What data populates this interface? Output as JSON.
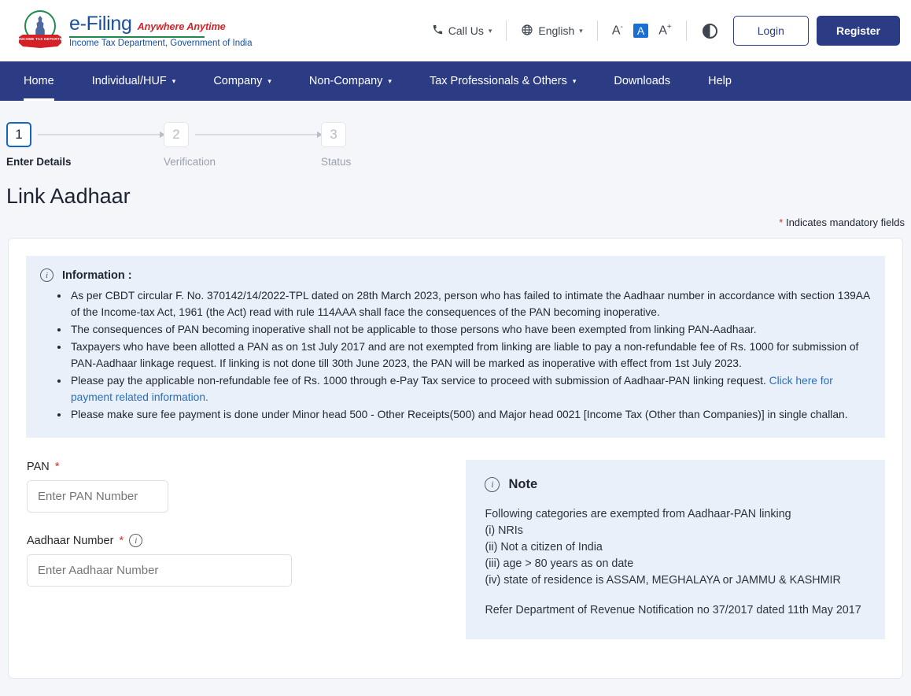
{
  "header": {
    "logo": {
      "emblem_icon": "india-state-emblem-icon",
      "ribbon_text": "INCOME TAX DEPARTMENT",
      "efiling": "e-Filing",
      "tagline": "Anywhere Anytime",
      "department": "Income Tax Department, Government of India"
    },
    "utils": {
      "call_us": "Call Us",
      "call_icon": "phone-icon",
      "language": "English",
      "globe_icon": "globe-icon",
      "font_decrease": "A",
      "font_decrease_sup": "-",
      "font_normal": "A",
      "font_increase": "A",
      "font_increase_sup": "+",
      "contrast_icon": "contrast-toggle-icon",
      "caret_icon": "chevron-down-icon",
      "login": "Login",
      "register": "Register"
    }
  },
  "nav": {
    "items": [
      {
        "label": "Home",
        "has_caret": false,
        "active": true
      },
      {
        "label": "Individual/HUF",
        "has_caret": true,
        "active": false
      },
      {
        "label": "Company",
        "has_caret": true,
        "active": false
      },
      {
        "label": "Non-Company",
        "has_caret": true,
        "active": false
      },
      {
        "label": "Tax Professionals & Others",
        "has_caret": true,
        "active": false
      },
      {
        "label": "Downloads",
        "has_caret": false,
        "active": false
      },
      {
        "label": "Help",
        "has_caret": false,
        "active": false
      }
    ]
  },
  "stepper": {
    "steps": [
      {
        "number": "1",
        "label": "Enter Details",
        "state": "current"
      },
      {
        "number": "2",
        "label": "Verification",
        "state": "idle"
      },
      {
        "number": "3",
        "label": "Status",
        "state": "idle"
      }
    ]
  },
  "page": {
    "title": "Link Aadhaar",
    "mandatory_asterisk": "*",
    "mandatory_note": "Indicates mandatory fields"
  },
  "information": {
    "icon": "info-circle-icon",
    "icon_glyph": "i",
    "title": "Information :",
    "bullets": [
      "As per CBDT circular F. No. 370142/14/2022-TPL dated on 28th March 2023, person who has failed to intimate the Aadhaar number in accordance with section 139AA of the Income-tax Act, 1961 (the Act) read with rule 114AAA shall face the consequences of the PAN becoming inoperative.",
      "The consequences of PAN becoming inoperative shall not be applicable to those persons who have been exempted from linking PAN-Aadhaar.",
      "Taxpayers who have been allotted a PAN as on 1st July 2017 and are not exempted from linking are liable to pay a non-refundable fee of Rs. 1000 for submission of PAN-Aadhaar linkage request. If linking is not done till 30th June 2023, the PAN will be marked as inoperative with effect from 1st July 2023."
    ],
    "bullet_with_link": {
      "text": "Please pay the applicable non-refundable fee of Rs. 1000 through e-Pay Tax service to proceed with submission of Aadhaar-PAN linking request. ",
      "link_text": "Click here for payment related information."
    },
    "last_bullet": "Please make sure fee payment is done under Minor head 500 - Other Receipts(500) and Major head 0021 [Income Tax (Other than Companies)] in single challan."
  },
  "form": {
    "pan": {
      "label": "PAN",
      "required_mark": "*",
      "placeholder": "Enter PAN Number",
      "value": ""
    },
    "aadhaar": {
      "label": "Aadhaar Number",
      "required_mark": "*",
      "info_icon": "info-circle-icon",
      "info_glyph": "i",
      "placeholder": "Enter Aadhaar Number",
      "value": ""
    }
  },
  "note": {
    "icon": "info-circle-icon",
    "icon_glyph": "i",
    "title": "Note",
    "intro": "Following categories are exempted from Aadhaar-PAN linking",
    "items": [
      "(i) NRIs",
      "(ii) Not a citizen of India",
      "(iii) age > 80 years as on date",
      "(iv) state of residence is ASSAM, MEGHALAYA or JAMMU & KASHMIR"
    ],
    "footer": "Refer Department of Revenue Notification no 37/2017 dated 11th May 2017"
  },
  "colors": {
    "nav_blue": "#2b3c84",
    "brand_blue": "#1a4fa0",
    "brand_red": "#d42027",
    "brand_green": "#1f8a4c",
    "info_bg": "#e9f0fa",
    "link_blue": "#2a6ebb",
    "page_bg": "#f4f6fa",
    "accent_active": "#1566c0"
  }
}
